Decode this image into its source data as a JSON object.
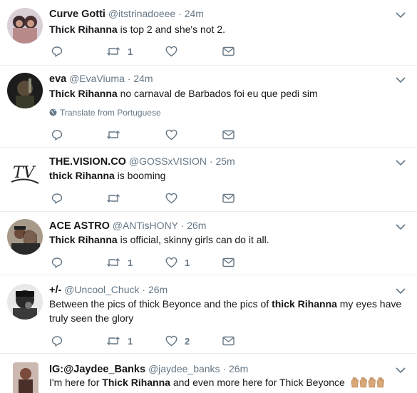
{
  "tweets": [
    {
      "name": "Curve Gotti",
      "handle": "@itstrinadoeee",
      "sep": "·",
      "time": "24m",
      "text_bold": "Thick Rihanna",
      "text_rest": " is top 2 and she's not 2.",
      "retweets": "1",
      "likes": ""
    },
    {
      "name": "eva",
      "handle": "@EvaViuma",
      "sep": "·",
      "time": "24m",
      "text_bold": "Thick Rihanna",
      "text_rest": " no carnaval de Barbados foi eu que pedi sim",
      "translate": "Translate from Portuguese",
      "retweets": "",
      "likes": ""
    },
    {
      "name": "THE.VISION.CO",
      "handle": "@GOSSxVISION",
      "sep": "·",
      "time": "25m",
      "text_bold": "thick Rihanna",
      "text_rest": " is booming",
      "retweets": "",
      "likes": ""
    },
    {
      "name": "ACE ASTRO",
      "handle": "@ANTisHONY",
      "sep": "·",
      "time": "26m",
      "text_bold": "Thick Rihanna",
      "text_rest": " is official, skinny girls can do it all.",
      "retweets": "1",
      "likes": "1"
    },
    {
      "name": "+/-",
      "handle": "@Uncool_Chuck",
      "sep": "·",
      "time": "26m",
      "text_pre": "Between the pics of thick Beyonce and the pics of ",
      "text_bold": "thick Rihanna",
      "text_rest": " my eyes have truly seen the glory",
      "retweets": "1",
      "likes": "2"
    },
    {
      "name": "IG:@Jaydee_Banks",
      "handle": "@jaydee_banks",
      "sep": "·",
      "time": "26m",
      "text_pre": "I'm here for ",
      "text_bold": "Thick Rihanna",
      "text_rest": " and even more here for Thick Beyonce",
      "emoji": "clapping-hands-x4",
      "retweets": "",
      "likes": ""
    }
  ],
  "colors": {
    "name": "#14171a",
    "secondary": "#657786",
    "divider": "#e6ecf0",
    "icon": "#657786"
  }
}
